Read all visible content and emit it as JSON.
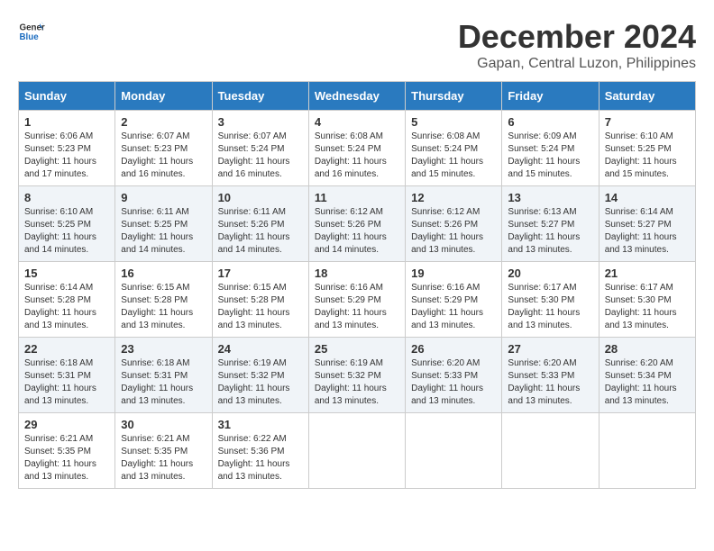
{
  "logo": {
    "line1": "General",
    "line2": "Blue"
  },
  "title": "December 2024",
  "location": "Gapan, Central Luzon, Philippines",
  "headers": [
    "Sunday",
    "Monday",
    "Tuesday",
    "Wednesday",
    "Thursday",
    "Friday",
    "Saturday"
  ],
  "weeks": [
    [
      {
        "day": "1",
        "sunrise": "6:06 AM",
        "sunset": "5:23 PM",
        "daylight": "11 hours and 17 minutes."
      },
      {
        "day": "2",
        "sunrise": "6:07 AM",
        "sunset": "5:23 PM",
        "daylight": "11 hours and 16 minutes."
      },
      {
        "day": "3",
        "sunrise": "6:07 AM",
        "sunset": "5:24 PM",
        "daylight": "11 hours and 16 minutes."
      },
      {
        "day": "4",
        "sunrise": "6:08 AM",
        "sunset": "5:24 PM",
        "daylight": "11 hours and 16 minutes."
      },
      {
        "day": "5",
        "sunrise": "6:08 AM",
        "sunset": "5:24 PM",
        "daylight": "11 hours and 15 minutes."
      },
      {
        "day": "6",
        "sunrise": "6:09 AM",
        "sunset": "5:24 PM",
        "daylight": "11 hours and 15 minutes."
      },
      {
        "day": "7",
        "sunrise": "6:10 AM",
        "sunset": "5:25 PM",
        "daylight": "11 hours and 15 minutes."
      }
    ],
    [
      {
        "day": "8",
        "sunrise": "6:10 AM",
        "sunset": "5:25 PM",
        "daylight": "11 hours and 14 minutes."
      },
      {
        "day": "9",
        "sunrise": "6:11 AM",
        "sunset": "5:25 PM",
        "daylight": "11 hours and 14 minutes."
      },
      {
        "day": "10",
        "sunrise": "6:11 AM",
        "sunset": "5:26 PM",
        "daylight": "11 hours and 14 minutes."
      },
      {
        "day": "11",
        "sunrise": "6:12 AM",
        "sunset": "5:26 PM",
        "daylight": "11 hours and 14 minutes."
      },
      {
        "day": "12",
        "sunrise": "6:12 AM",
        "sunset": "5:26 PM",
        "daylight": "11 hours and 13 minutes."
      },
      {
        "day": "13",
        "sunrise": "6:13 AM",
        "sunset": "5:27 PM",
        "daylight": "11 hours and 13 minutes."
      },
      {
        "day": "14",
        "sunrise": "6:14 AM",
        "sunset": "5:27 PM",
        "daylight": "11 hours and 13 minutes."
      }
    ],
    [
      {
        "day": "15",
        "sunrise": "6:14 AM",
        "sunset": "5:28 PM",
        "daylight": "11 hours and 13 minutes."
      },
      {
        "day": "16",
        "sunrise": "6:15 AM",
        "sunset": "5:28 PM",
        "daylight": "11 hours and 13 minutes."
      },
      {
        "day": "17",
        "sunrise": "6:15 AM",
        "sunset": "5:28 PM",
        "daylight": "11 hours and 13 minutes."
      },
      {
        "day": "18",
        "sunrise": "6:16 AM",
        "sunset": "5:29 PM",
        "daylight": "11 hours and 13 minutes."
      },
      {
        "day": "19",
        "sunrise": "6:16 AM",
        "sunset": "5:29 PM",
        "daylight": "11 hours and 13 minutes."
      },
      {
        "day": "20",
        "sunrise": "6:17 AM",
        "sunset": "5:30 PM",
        "daylight": "11 hours and 13 minutes."
      },
      {
        "day": "21",
        "sunrise": "6:17 AM",
        "sunset": "5:30 PM",
        "daylight": "11 hours and 13 minutes."
      }
    ],
    [
      {
        "day": "22",
        "sunrise": "6:18 AM",
        "sunset": "5:31 PM",
        "daylight": "11 hours and 13 minutes."
      },
      {
        "day": "23",
        "sunrise": "6:18 AM",
        "sunset": "5:31 PM",
        "daylight": "11 hours and 13 minutes."
      },
      {
        "day": "24",
        "sunrise": "6:19 AM",
        "sunset": "5:32 PM",
        "daylight": "11 hours and 13 minutes."
      },
      {
        "day": "25",
        "sunrise": "6:19 AM",
        "sunset": "5:32 PM",
        "daylight": "11 hours and 13 minutes."
      },
      {
        "day": "26",
        "sunrise": "6:20 AM",
        "sunset": "5:33 PM",
        "daylight": "11 hours and 13 minutes."
      },
      {
        "day": "27",
        "sunrise": "6:20 AM",
        "sunset": "5:33 PM",
        "daylight": "11 hours and 13 minutes."
      },
      {
        "day": "28",
        "sunrise": "6:20 AM",
        "sunset": "5:34 PM",
        "daylight": "11 hours and 13 minutes."
      }
    ],
    [
      {
        "day": "29",
        "sunrise": "6:21 AM",
        "sunset": "5:35 PM",
        "daylight": "11 hours and 13 minutes."
      },
      {
        "day": "30",
        "sunrise": "6:21 AM",
        "sunset": "5:35 PM",
        "daylight": "11 hours and 13 minutes."
      },
      {
        "day": "31",
        "sunrise": "6:22 AM",
        "sunset": "5:36 PM",
        "daylight": "11 hours and 13 minutes."
      },
      null,
      null,
      null,
      null
    ]
  ],
  "labels": {
    "sunrise": "Sunrise: ",
    "sunset": "Sunset: ",
    "daylight": "Daylight: "
  }
}
